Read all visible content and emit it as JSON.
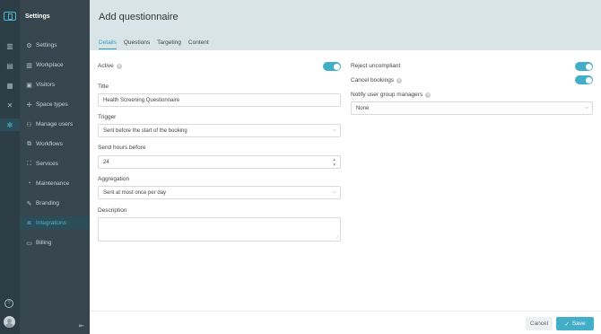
{
  "sidebar": {
    "title": "Settings",
    "items": [
      {
        "label": "Settings",
        "icon": "gear-icon"
      },
      {
        "label": "Workplace",
        "icon": "building-icon"
      },
      {
        "label": "Visitors",
        "icon": "visitor-icon"
      },
      {
        "label": "Space types",
        "icon": "space-types-icon"
      },
      {
        "label": "Manage users",
        "icon": "users-icon"
      },
      {
        "label": "Workflows",
        "icon": "workflows-icon"
      },
      {
        "label": "Services",
        "icon": "services-icon"
      },
      {
        "label": "Maintenance",
        "icon": "maintenance-icon"
      },
      {
        "label": "Branding",
        "icon": "branding-icon"
      },
      {
        "label": "Integrations",
        "icon": "integrations-icon"
      },
      {
        "label": "Billing",
        "icon": "billing-icon"
      }
    ],
    "active_item": "Integrations"
  },
  "header": {
    "title": "Add questionnaire",
    "tabs": [
      "Details",
      "Questions",
      "Targeting",
      "Content"
    ],
    "active_tab": "Details"
  },
  "form": {
    "active_label": "Active",
    "title_label": "Title",
    "title_value": "Health Screening Questionnaire",
    "trigger_label": "Trigger",
    "trigger_value": "Sent before the start of the booking",
    "send_hours_label": "Send hours before",
    "send_hours_value": "24",
    "aggregation_label": "Aggregation",
    "aggregation_value": "Sent at most once per day",
    "description_label": "Description",
    "reject_label": "Reject uncompliant",
    "cancel_bookings_label": "Cancel bookings",
    "notify_label": "Notify user group managers",
    "notify_value": "None"
  },
  "footer": {
    "cancel_label": "Cancel",
    "save_label": "Save"
  },
  "colors": {
    "accent": "#43aec8",
    "rail": "#2d3d45",
    "sidebar": "#37464e",
    "header": "#d8e4e8"
  }
}
